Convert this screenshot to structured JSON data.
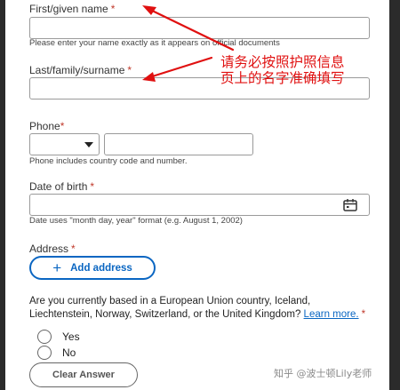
{
  "form": {
    "first_name": {
      "label": "First/given name",
      "required_mark": "*",
      "value": "",
      "hint": "Please enter your name exactly as it appears on official documents"
    },
    "last_name": {
      "label": "Last/family/surname",
      "required_mark": "*",
      "value": ""
    },
    "phone": {
      "label": "Phone",
      "required_mark": "*",
      "country_code_value": "",
      "number_value": "",
      "hint": "Phone includes country code and number."
    },
    "dob": {
      "label": "Date of birth",
      "required_mark": "*",
      "value": "",
      "hint": "Date uses \"month day, year\" format (e.g. August 1, 2002)"
    },
    "address": {
      "label": "Address",
      "required_mark": "*",
      "add_button_label": "Add address"
    },
    "eu_question": {
      "text": "Are you currently based in a European Union country, Iceland, Liechtenstein, Norway, Switzerland, or the United Kingdom?",
      "learn_more": "Learn more.",
      "required_mark": "*",
      "options": [
        "Yes",
        "No"
      ],
      "clear_label": "Clear Answer"
    }
  },
  "annotation": {
    "line1": "请务必按照护照信息",
    "line2": "页上的名字准确填写",
    "color": "#e01010"
  },
  "watermark": "知乎 @波士顿Lily老师",
  "icons": {
    "dropdown": "caret-down-icon",
    "calendar": "calendar-icon",
    "add": "plus-icon"
  },
  "colors": {
    "accent": "#0a66c2",
    "required": "#c0392b"
  }
}
